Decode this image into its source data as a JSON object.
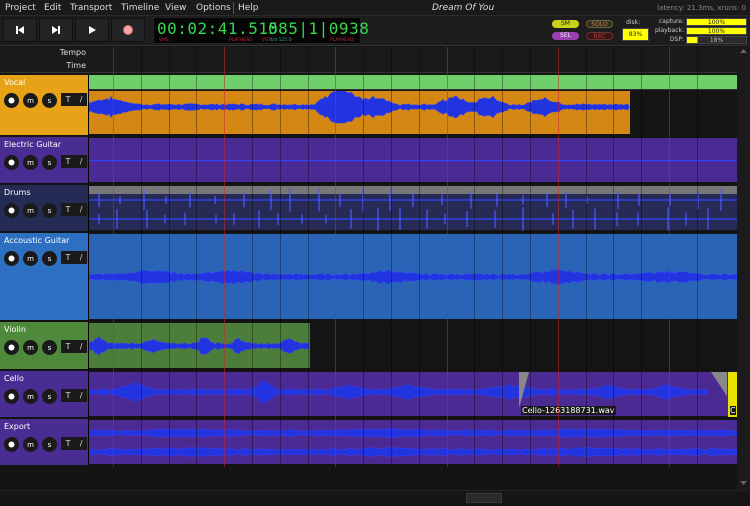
{
  "menu": [
    "Project",
    "Edit",
    "Transport",
    "Timeline",
    "View",
    "Options",
    "Help"
  ],
  "title": "Dream Of You",
  "latency": "latency: 21.3ms, xruns: 0",
  "clock": {
    "time": "00:02:41.515",
    "bbt": "085|1|0938",
    "time_labels": [
      "VMS",
      "PLAYHEAD",
      "VST"
    ],
    "bbt_labels": [
      "4/4 125.0",
      "PLAYHEAD"
    ]
  },
  "pills": {
    "sm": "SM",
    "solo": "SOLO",
    "sel": "SEL",
    "rec": "REC"
  },
  "disk": {
    "label": "disk:",
    "value": "83%"
  },
  "meters": {
    "capture_label": "capture:",
    "capture": "100%",
    "playback_label": "playback:",
    "playback": "100%",
    "dsp_label": "DSP:",
    "dsp": "18%"
  },
  "rulers": {
    "tempo": "Tempo",
    "time": "Time"
  },
  "track_buttons": {
    "mute": "m",
    "solo": "s",
    "t": "T",
    "slash": "/"
  },
  "tracks": [
    {
      "name": "Vocal",
      "color": "#e8a218"
    },
    {
      "name": "Electric Guitar",
      "color": "#4a2d92"
    },
    {
      "name": "Drums",
      "color": "#242c56"
    },
    {
      "name": "Accoustic Guitar",
      "color": "#2d6fc0"
    },
    {
      "name": "Violin",
      "color": "#4f8a3c"
    },
    {
      "name": "Cello",
      "color": "#4a2d92"
    },
    {
      "name": "Export",
      "color": "#4a2d92"
    }
  ],
  "region_labels": {
    "cello": "Cello-1263188731.wav",
    "cello_end": "C"
  }
}
